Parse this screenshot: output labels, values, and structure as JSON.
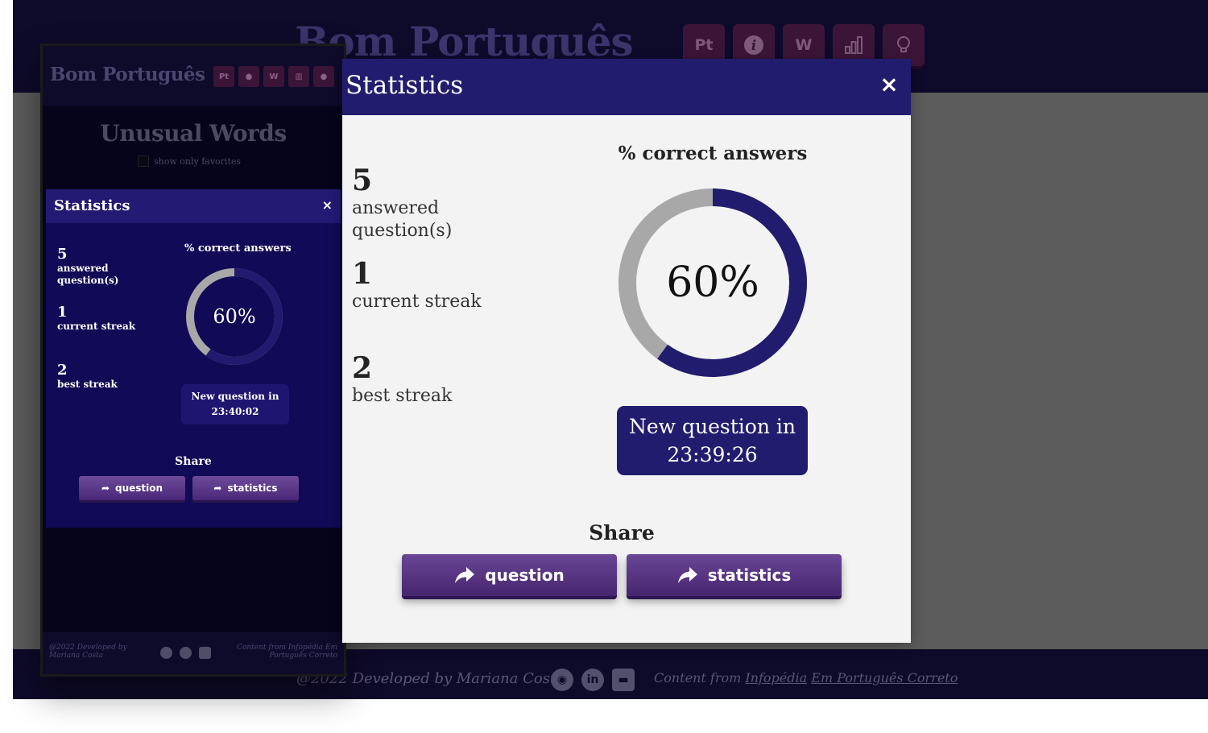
{
  "background": {
    "title": "Bom Português",
    "nav_icons": [
      {
        "icon": "portuguese-flag-icon",
        "label": "Pt"
      },
      {
        "icon": "info-icon",
        "label": "i"
      },
      {
        "icon": "unusual-words-icon",
        "label": "W"
      },
      {
        "icon": "statistics-icon",
        "label": ""
      },
      {
        "icon": "lightbulb-icon",
        "label": ""
      }
    ],
    "footer": {
      "developed_by": "@2022 Developed by Mariana Costa",
      "content_from": "Content from",
      "links": [
        "Infopédia",
        "Em Português Correto"
      ]
    }
  },
  "phone_preview": {
    "title": "Bom Português",
    "nav_icons": [
      "Pt",
      "i",
      "W",
      "",
      ""
    ],
    "page_heading": "Unusual Words",
    "favorites_label": "show only favorites",
    "modal": {
      "title": "Statistics",
      "close": "×",
      "stats": [
        {
          "value": "5",
          "label": "answered question(s)"
        },
        {
          "value": "1",
          "label": "current streak"
        },
        {
          "value": "2",
          "label": "best streak"
        }
      ],
      "correct_label": "% correct answers",
      "correct_percent": "60%",
      "correct_fraction": 0.6,
      "next_question_label": "New question in",
      "next_question_time": "23:40:02",
      "share_label": "Share",
      "share_question": "question",
      "share_statistics": "statistics"
    },
    "footer": {
      "developed_by": "@2022 Developed by Mariana Costa",
      "content_from": "Content from Infopédia Em Português Correto"
    }
  },
  "modal": {
    "title": "Statistics",
    "close": "×",
    "stats": [
      {
        "value": "5",
        "label": "answered question(s)"
      },
      {
        "value": "1",
        "label": "current streak"
      },
      {
        "value": "2",
        "label": "best streak"
      }
    ],
    "correct_label": "% correct answers",
    "correct_percent": "60%",
    "correct_fraction": 0.6,
    "next_question_label": "New question in",
    "next_question_time": "23:39:26",
    "share_label": "Share",
    "share_question": "question",
    "share_statistics": "statistics"
  },
  "colors": {
    "accent": "#221c6e",
    "button": "#5a3585",
    "ring_track": "#a8a8a8"
  }
}
